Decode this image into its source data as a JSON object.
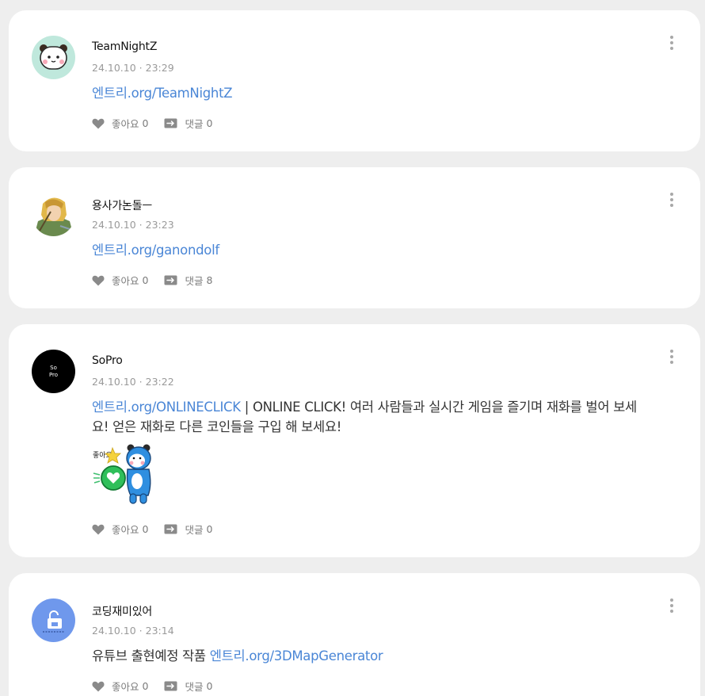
{
  "posts": [
    {
      "author": "TeamNightZ",
      "date": "24.10.10",
      "time": "23:29",
      "link_text": "엔트리.org/TeamNightZ",
      "like_label": "좋아요",
      "like_count": "0",
      "comment_label": "댓글",
      "comment_count": "0",
      "avatar_icon": "white-bear-face-icon"
    },
    {
      "author": "용사가논돌ㅡ",
      "date": "24.10.10",
      "time": "23:23",
      "link_text": "엔트리.org/ganondolf",
      "like_label": "좋아요",
      "like_count": "0",
      "comment_label": "댓글",
      "comment_count": "8",
      "avatar_icon": "game-character-icon"
    },
    {
      "author": "SoPro",
      "date": "24.10.10",
      "time": "23:22",
      "link_text": "엔트리.org/ONLINECLICK",
      "text_after_link": " | ONLINE CLICK! 여러 사람들과 실시간 게임을 즐기며 재화를 벌어 보세요! 얻은 재화로 다른 코인들을 구입 해 보세요!",
      "sticker_text": "좋아요",
      "avatar_text_line1": "So",
      "avatar_text_line2": "Pro",
      "like_label": "좋아요",
      "like_count": "0",
      "comment_label": "댓글",
      "comment_count": "0",
      "avatar_icon": "sopro-logo-icon"
    },
    {
      "author": "코딩재미있어",
      "date": "24.10.10",
      "time": "23:14",
      "text_before_link": "유튜브 출현예정 작품 ",
      "link_text": "엔트리.org/3DMapGenerator",
      "like_label": "좋아요",
      "like_count": "0",
      "comment_label": "댓글",
      "comment_count": "0",
      "avatar_icon": "blue-lock-icon"
    }
  ],
  "colors": {
    "link": "#4a86d6",
    "card_bg": "#ffffff",
    "page_bg": "#eeeeee",
    "meta": "#9a9a9a"
  },
  "icons": {
    "more": "more-vertical-icon",
    "like": "heart-icon",
    "comment": "comment-arrow-icon"
  }
}
